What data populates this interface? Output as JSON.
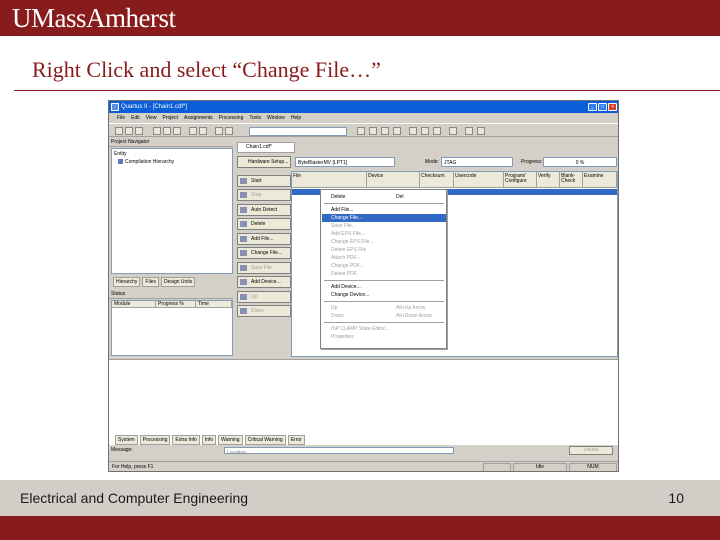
{
  "header": {
    "logo": "UMassAmherst"
  },
  "slide": {
    "title": "Right Click and select “Change File…”"
  },
  "app": {
    "window_title": "Quartus II - [Chain1.cdf*]",
    "menu": [
      "File",
      "Edit",
      "View",
      "Project",
      "Assignments",
      "Processing",
      "Tools",
      "Window",
      "Help"
    ],
    "navigator": {
      "title": "Project Navigator",
      "col": "Entity",
      "item": "Compilation Hierarchy",
      "tabs": [
        "Hierarchy",
        "Files",
        "Design Units"
      ]
    },
    "status": {
      "title": "Status",
      "columns": [
        "Module",
        "Progress %",
        "Time"
      ]
    },
    "chain_tab": "Chain1.cdf*",
    "hardware": {
      "button": "Hardware Setup...",
      "value": "ByteBlasterMV [LPT1]",
      "mode_label": "Mode:",
      "mode_value": "JTAG",
      "progress_label": "Progress:",
      "progress_value": "0 %"
    },
    "side_buttons": [
      {
        "label": "Start",
        "disabled": false
      },
      {
        "label": "Stop",
        "disabled": true
      },
      {
        "label": "Auto Detect",
        "disabled": false
      },
      {
        "label": "Delete",
        "disabled": false
      },
      {
        "label": "Add File...",
        "disabled": false
      },
      {
        "label": "Change File...",
        "disabled": false
      },
      {
        "label": "Save File",
        "disabled": true
      },
      {
        "label": "Add Device...",
        "disabled": false
      },
      {
        "label": "Up",
        "disabled": true
      },
      {
        "label": "Down",
        "disabled": true
      }
    ],
    "grid_columns": [
      "File",
      "Device",
      "Checksum",
      "Usercode",
      "Program/ Configure",
      "Verify",
      "Blank-Check",
      "Examine"
    ],
    "context_menu": [
      {
        "label": "Delete",
        "shortcut": "Del",
        "state": "normal"
      },
      {
        "separator": true
      },
      {
        "label": "Add File...",
        "state": "normal"
      },
      {
        "label": "Change File...",
        "state": "selected"
      },
      {
        "label": "Save File...",
        "state": "disabled"
      },
      {
        "label": "Add EPS File...",
        "state": "disabled"
      },
      {
        "label": "Change EPS File...",
        "state": "disabled"
      },
      {
        "label": "Delete EPS File",
        "state": "disabled"
      },
      {
        "label": "Attach PDF...",
        "state": "disabled"
      },
      {
        "label": "Change PDF...",
        "state": "disabled"
      },
      {
        "label": "Delete PDF",
        "state": "disabled"
      },
      {
        "separator": true
      },
      {
        "label": "Add Device...",
        "state": "normal"
      },
      {
        "label": "Change Device...",
        "state": "normal"
      },
      {
        "separator": true
      },
      {
        "label": "Up",
        "shortcut": "Alt+Up Arrow",
        "state": "disabled"
      },
      {
        "label": "Down",
        "shortcut": "Alt+Down Arrow",
        "state": "disabled"
      },
      {
        "separator": true
      },
      {
        "label": "ISP CLAMP State Editor...",
        "state": "disabled"
      },
      {
        "label": "Properties",
        "state": "disabled"
      }
    ],
    "message_tabs": [
      "System",
      "Processing",
      "Extra Info",
      "Info",
      "Warning",
      "Critical Warning",
      "Error"
    ],
    "message_label": "Message:",
    "location_placeholder": "Location:",
    "locate_button": "Locate",
    "statusbar": {
      "hint": "For Help, press F1",
      "idle": "Idle",
      "num": "NUM"
    }
  },
  "footer": {
    "department": "Electrical and Computer Engineering",
    "page": "10"
  },
  "colors": {
    "maroon": "#881c1c",
    "footer_gray": "#d3cdc8",
    "selection_blue": "#316ac5"
  },
  "icons": [
    "app-icon",
    "minimize-icon",
    "maximize-icon",
    "close-icon",
    "new-file-icon",
    "open-icon",
    "save-icon",
    "compile-icon",
    "programmer-icon",
    "help-icon"
  ]
}
